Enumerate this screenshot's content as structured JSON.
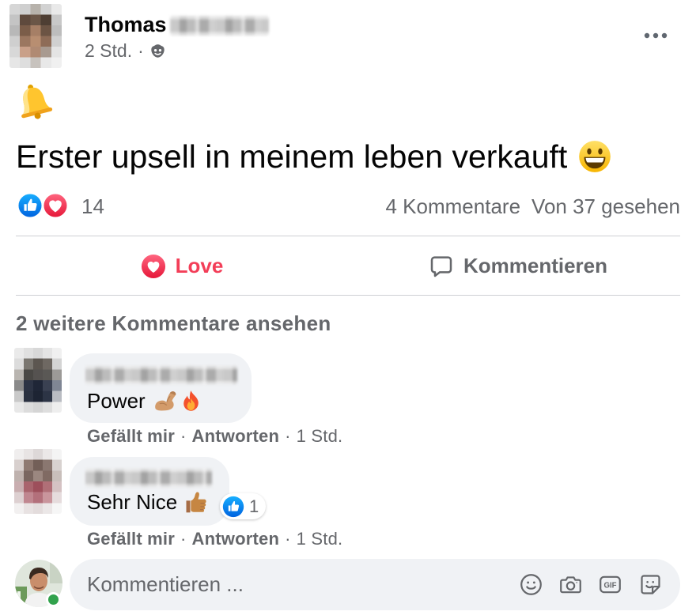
{
  "post": {
    "author_first_name": "Thomas",
    "time": "2 Std.",
    "meta_separator": "·",
    "text": "Erster upsell in meinem leben verkauft",
    "text_emoji": "grinning-face",
    "reaction_count": "14",
    "reaction_types": [
      "like",
      "love"
    ],
    "comment_count": "4 Kommentare",
    "seen_count": "Von 37 gesehen"
  },
  "actions": {
    "love": "Love",
    "comment": "Kommentieren"
  },
  "view_more_comments": "2 weitere Kommentare ansehen",
  "comments": [
    {
      "text": "Power",
      "emojis": [
        "flexed-biceps",
        "fire"
      ],
      "like": "Gefällt mir",
      "separator": "·",
      "reply": "Antworten",
      "time": "1 Std."
    },
    {
      "text": "Sehr Nice",
      "emojis": [
        "thumbs-up"
      ],
      "reaction_count": "1",
      "like": "Gefällt mir",
      "separator": "·",
      "reply": "Antworten",
      "time": "1 Std."
    }
  ],
  "composer": {
    "placeholder": "Kommentieren ...",
    "gif_label": "GIF",
    "icons": [
      "smiley-icon",
      "camera-icon",
      "gif-icon",
      "sticker-icon"
    ]
  },
  "icons": {
    "post_emoji": "bell-emoji-icon",
    "audience": "friends-audience-icon",
    "more": "more-dots-icon"
  },
  "colors": {
    "love": "#f33e58",
    "like": "#1877f2",
    "secondary_text": "#65676b",
    "bubble": "#f0f2f5",
    "divider": "#ced0d4",
    "online": "#31a24c"
  }
}
